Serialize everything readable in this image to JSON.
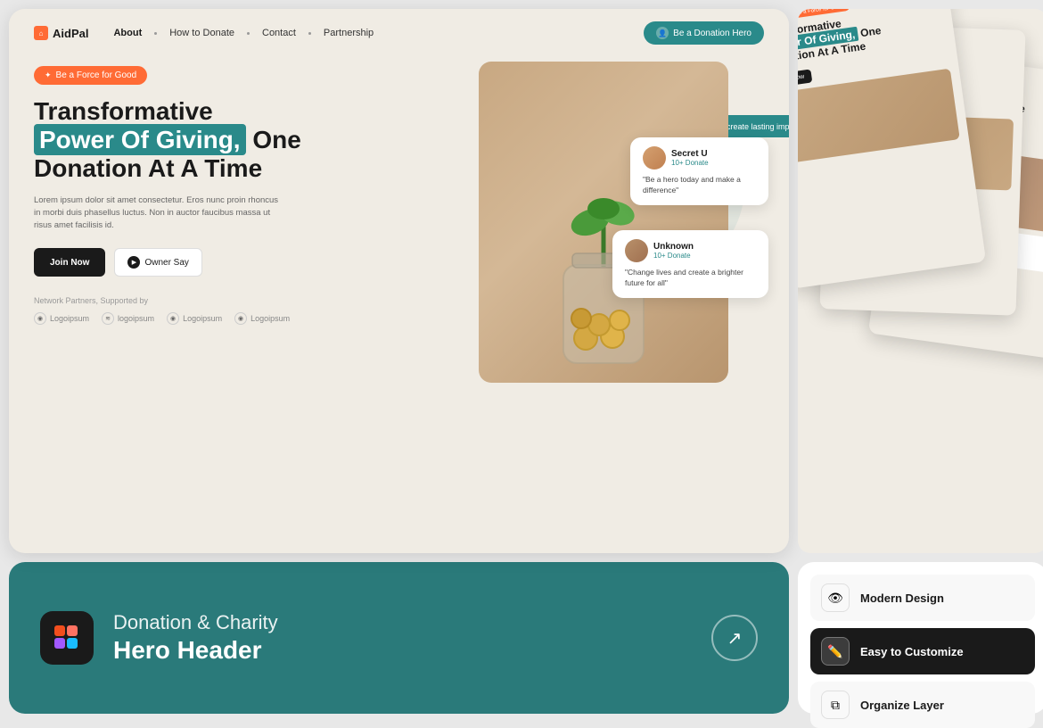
{
  "navbar": {
    "logo": "AidPal",
    "links": [
      "About",
      "How to Donate",
      "Contact",
      "Partnership"
    ],
    "cta": "Be a Donation Hero"
  },
  "hero": {
    "badge": "Be a Force for Good",
    "title_line1": "Transformative",
    "title_highlight": "Power Of Giving,",
    "title_line2": " One",
    "title_line3": "Donation At A Time",
    "description": "Lorem ipsum dolor sit amet consectetur. Eros nunc proin rhoncus in morbi duis phasellus luctus. Non in auctor faucibus massa ut risus amet facilisis id.",
    "btn_join": "Join Now",
    "btn_owner": "Owner Say",
    "partners_label": "Network Partners, Supported by",
    "partners": [
      "Logoipsum",
      "logoipsum",
      "Logoipsum",
      "Logoipsum"
    ]
  },
  "floating_top": {
    "text": "Change lives and create lasting impact"
  },
  "card_right": {
    "name": "Secret U",
    "sub": "10+ Donate",
    "quote": "\"Be a hero today and make a difference\""
  },
  "card_bottom": {
    "name": "Unknown",
    "sub": "10+ Donate",
    "quote": "\"Change lives and create a brighter future for all\""
  },
  "title_banner": {
    "category": "Donation & Charity",
    "main": "Hero Header",
    "icon": "🎨"
  },
  "features": [
    {
      "icon": "👁",
      "label": "Modern Design",
      "active": false
    },
    {
      "icon": "✏️",
      "label": "Easy to Customize",
      "active": true
    },
    {
      "icon": "⧉",
      "label": "Organize Layer",
      "active": false
    }
  ]
}
